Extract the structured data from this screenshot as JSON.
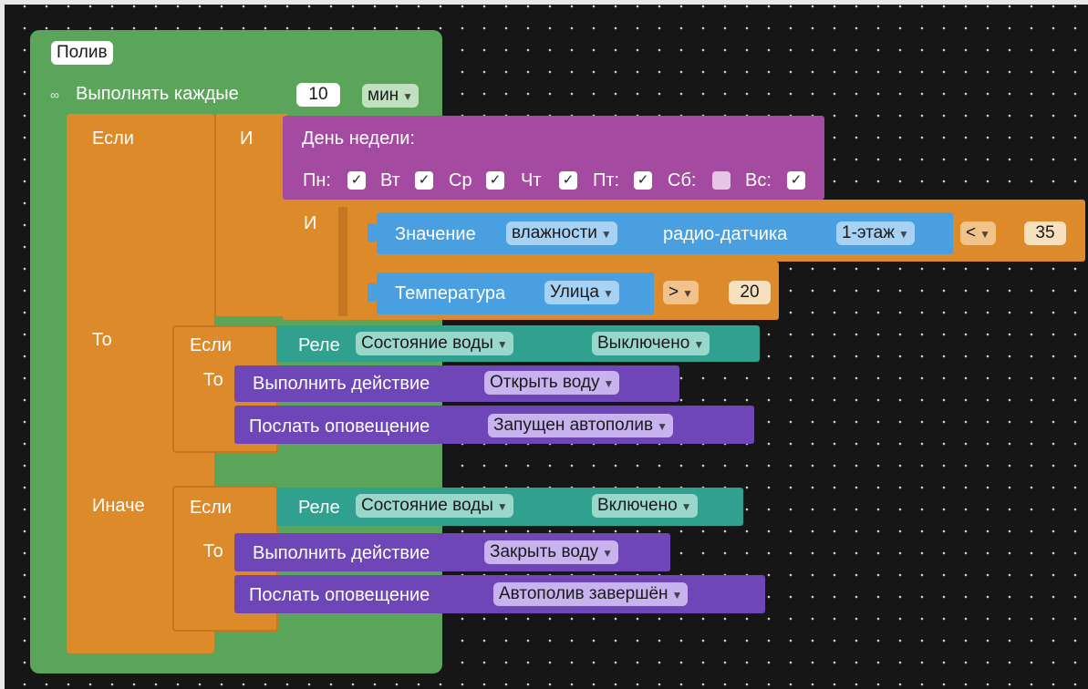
{
  "title": "Полив",
  "loop": {
    "label": "Выполнять каждые",
    "interval": "10",
    "unit": "мин",
    "icon": "infinity-icon"
  },
  "if_block": {
    "if_label": "Если",
    "then_label": "То",
    "else_label": "Иначе"
  },
  "and1": {
    "label": "И"
  },
  "weekday": {
    "title": "День недели:",
    "days": [
      {
        "label": "Пн:",
        "checked": true
      },
      {
        "label": "Вт",
        "checked": true
      },
      {
        "label": "Ср",
        "checked": true
      },
      {
        "label": "Чт",
        "checked": true
      },
      {
        "label": "Пт:",
        "checked": true
      },
      {
        "label": "Сб:",
        "checked": false
      },
      {
        "label": "Вс:",
        "checked": true
      }
    ]
  },
  "and2": {
    "label": "И"
  },
  "humidity": {
    "label1": "Значение",
    "param": "влажности",
    "label2": "радио-датчика",
    "sensor": "1-этаж",
    "op": "<",
    "value": "35"
  },
  "temperature": {
    "label": "Температура",
    "location": "Улица",
    "op": ">",
    "value": "20"
  },
  "then_branch": {
    "if_label": "Если",
    "then_label": "То",
    "relay_label": "Реле",
    "relay_name": "Состояние воды",
    "relay_state": "Выключено",
    "action_label": "Выполнить действие",
    "action_value": "Открыть воду",
    "notify_label": "Послать оповещение",
    "notify_value": "Запущен автополив"
  },
  "else_branch": {
    "if_label": "Если",
    "then_label": "То",
    "relay_label": "Реле",
    "relay_name": "Состояние воды",
    "relay_state": "Включено",
    "action_label": "Выполнить действие",
    "action_value": "Закрыть воду",
    "notify_label": "Послать оповещение",
    "notify_value": "Автополив завершён"
  },
  "dropdown_arrow": "▼",
  "colors": {
    "workspace": "#161616",
    "event_block": "#5ba55b",
    "logic_block": "#dd8a2b",
    "weekday_block": "#a44ba1",
    "sensor_block": "#4a9fe0",
    "relay_block": "#2fa18e",
    "action_block": "#6e46b8"
  }
}
